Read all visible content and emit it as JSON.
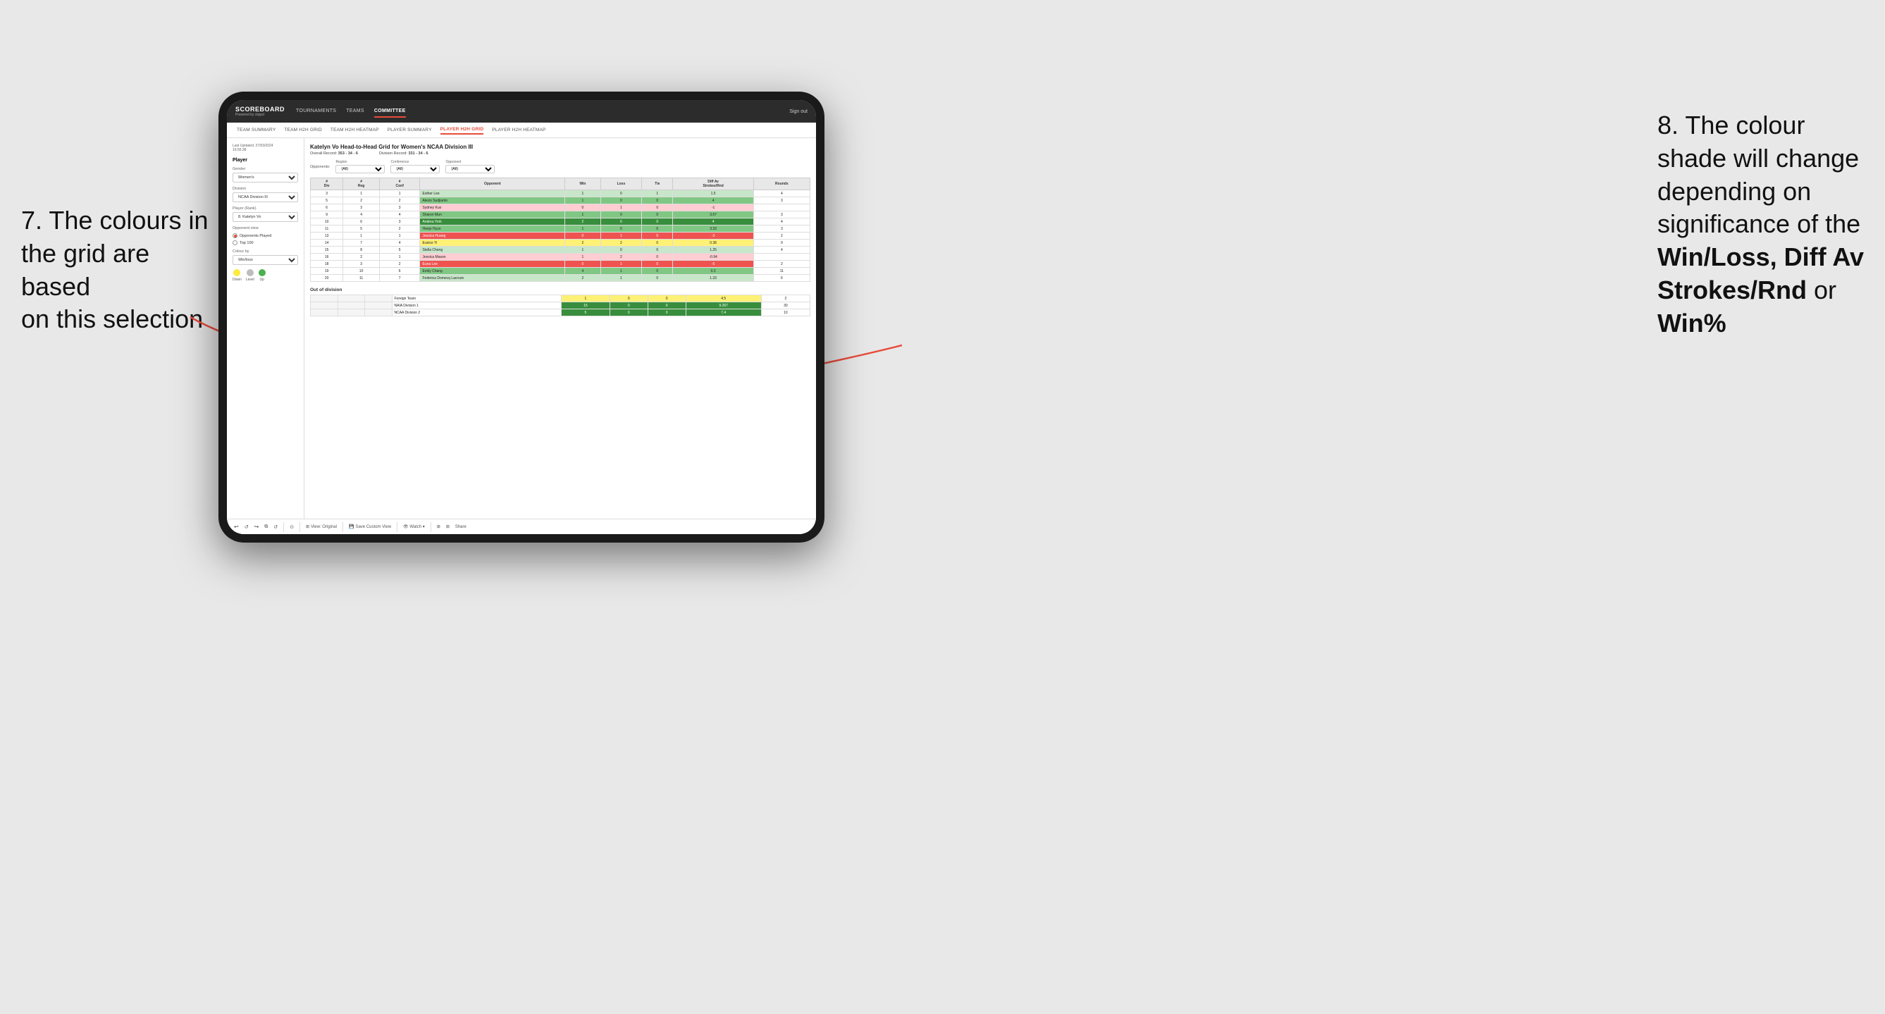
{
  "annotations": {
    "left_text_line1": "7. The colours in",
    "left_text_line2": "the grid are based",
    "left_text_line3": "on this selection",
    "right_text_line1": "8. The colour",
    "right_text_line2": "shade will change",
    "right_text_line3": "depending on",
    "right_text_line4": "significance of the",
    "right_text_bold1": "Win/Loss,",
    "right_text_bold2": "Diff Av",
    "right_text_bold3": "Strokes/Rnd",
    "right_text_or": "or",
    "right_text_bold4": "Win%"
  },
  "navbar": {
    "logo": "SCOREBOARD",
    "powered_by": "Powered by clippd",
    "items": [
      "TOURNAMENTS",
      "TEAMS",
      "COMMITTEE"
    ],
    "active_item": "COMMITTEE",
    "sign_out": "Sign out"
  },
  "subnav": {
    "items": [
      "TEAM SUMMARY",
      "TEAM H2H GRID",
      "TEAM H2H HEATMAP",
      "PLAYER SUMMARY",
      "PLAYER H2H GRID",
      "PLAYER H2H HEATMAP"
    ],
    "active_item": "PLAYER H2H GRID"
  },
  "sidebar": {
    "last_updated_label": "Last Updated: 27/03/2024",
    "last_updated_time": "16:55:38",
    "player_label": "Player",
    "gender_label": "Gender",
    "gender_value": "Women's",
    "division_label": "Division",
    "division_value": "NCAA Division III",
    "player_rank_label": "Player (Rank)",
    "player_rank_value": "8. Katelyn Vo",
    "opponent_view_label": "Opponent view",
    "opponent_opponents": "Opponents Played",
    "opponent_top100": "Top 100",
    "colour_by_label": "Colour by",
    "colour_by_value": "Win/loss",
    "legend": {
      "down_label": "Down",
      "level_label": "Level",
      "up_label": "Up"
    }
  },
  "grid": {
    "title": "Katelyn Vo Head-to-Head Grid for Women's NCAA Division III",
    "overall_record_label": "Overall Record:",
    "overall_record_value": "353 - 34 - 6",
    "division_record_label": "Division Record:",
    "division_record_value": "331 - 34 - 6",
    "filters": {
      "region_label": "Region",
      "region_value": "(All)",
      "conference_label": "Conference",
      "conference_value": "(All)",
      "opponent_label": "Opponent",
      "opponent_value": "(All)"
    },
    "table_headers": {
      "div": "#\nDiv",
      "reg": "#\nReg",
      "conf": "#\nConf",
      "opponent": "Opponent",
      "win": "Win",
      "loss": "Loss",
      "tie": "Tie",
      "diff_av": "Diff Av\nStrokes/Rnd",
      "rounds": "Rounds"
    },
    "rows": [
      {
        "div": 3,
        "reg": 1,
        "conf": 1,
        "name": "Esther Lee",
        "win": 1,
        "loss": 0,
        "tie": 1,
        "diff": 1.5,
        "rounds": 4,
        "color": "green-light"
      },
      {
        "div": 5,
        "reg": 2,
        "conf": 2,
        "name": "Alexis Sudjianto",
        "win": 1,
        "loss": 0,
        "tie": 0,
        "diff": 4.0,
        "rounds": 3,
        "color": "green"
      },
      {
        "div": 6,
        "reg": 3,
        "conf": 3,
        "name": "Sydney Kuo",
        "win": 0,
        "loss": 1,
        "tie": 0,
        "diff": -1.0,
        "rounds": "",
        "color": "red-light"
      },
      {
        "div": 9,
        "reg": 4,
        "conf": 4,
        "name": "Sharon Mun",
        "win": 1,
        "loss": 0,
        "tie": 0,
        "diff": 3.67,
        "rounds": 3,
        "color": "green"
      },
      {
        "div": 10,
        "reg": 6,
        "conf": 3,
        "name": "Andrea York",
        "win": 2,
        "loss": 0,
        "tie": 0,
        "diff": 4.0,
        "rounds": 4,
        "color": "green-dark"
      },
      {
        "div": 11,
        "reg": 5,
        "conf": 2,
        "name": "Heejo Hyun",
        "win": 1,
        "loss": 0,
        "tie": 0,
        "diff": 3.33,
        "rounds": 3,
        "color": "green"
      },
      {
        "div": 13,
        "reg": 1,
        "conf": 1,
        "name": "Jessica Huang",
        "win": 0,
        "loss": 1,
        "tie": 0,
        "diff": -3.0,
        "rounds": 2,
        "color": "red"
      },
      {
        "div": 14,
        "reg": 7,
        "conf": 4,
        "name": "Eunice Yi",
        "win": 2,
        "loss": 2,
        "tie": 0,
        "diff": 0.38,
        "rounds": 9,
        "color": "yellow"
      },
      {
        "div": 15,
        "reg": 8,
        "conf": 5,
        "name": "Stella Cheng",
        "win": 1,
        "loss": 0,
        "tie": 0,
        "diff": 1.25,
        "rounds": 4,
        "color": "green-light"
      },
      {
        "div": 16,
        "reg": 2,
        "conf": 1,
        "name": "Jessica Mason",
        "win": 1,
        "loss": 2,
        "tie": 0,
        "diff": -0.94,
        "rounds": "",
        "color": "red-light"
      },
      {
        "div": 18,
        "reg": 3,
        "conf": 2,
        "name": "Euna Lee",
        "win": 0,
        "loss": 1,
        "tie": 0,
        "diff": -5.0,
        "rounds": 2,
        "color": "red"
      },
      {
        "div": 19,
        "reg": 10,
        "conf": 6,
        "name": "Emily Chang",
        "win": 4,
        "loss": 1,
        "tie": 0,
        "diff": 0.3,
        "rounds": 11,
        "color": "green"
      },
      {
        "div": 20,
        "reg": 11,
        "conf": 7,
        "name": "Federica Domecq Lacroze",
        "win": 2,
        "loss": 1,
        "tie": 0,
        "diff": 1.33,
        "rounds": 6,
        "color": "green-light"
      }
    ],
    "out_of_division_label": "Out of division",
    "out_of_division_rows": [
      {
        "name": "Foreign Team",
        "win": 1,
        "loss": 0,
        "tie": 0,
        "diff": 4.5,
        "rounds": 2,
        "color": "yellow"
      },
      {
        "name": "NAIA Division 1",
        "win": 15,
        "loss": 0,
        "tie": 0,
        "diff": 9.267,
        "rounds": 30,
        "color": "green-dark"
      },
      {
        "name": "NCAA Division 2",
        "win": 5,
        "loss": 0,
        "tie": 0,
        "diff": 7.4,
        "rounds": 10,
        "color": "green-dark"
      }
    ]
  },
  "toolbar": {
    "items": [
      "↩",
      "⤾",
      "↪",
      "⧉",
      "⟳",
      "·",
      "⊙",
      "|",
      "View: Original",
      "|",
      "Save Custom View",
      "|",
      "👁 Watch ▾",
      "|",
      "⬡",
      "⋮⋮",
      "Share"
    ]
  }
}
